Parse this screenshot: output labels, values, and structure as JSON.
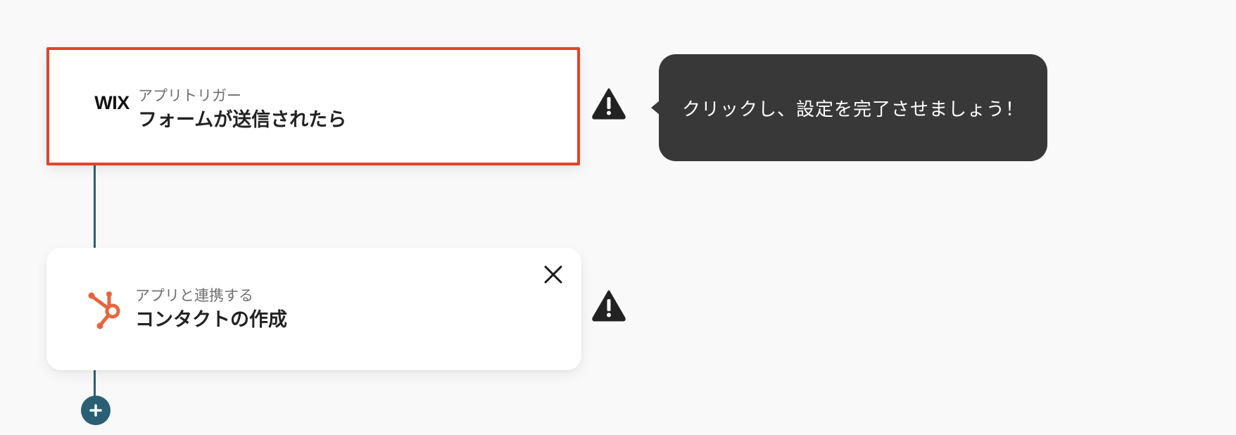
{
  "flow": {
    "trigger": {
      "app_logo_text": "WIX",
      "label": "アプリトリガー",
      "title": "フォームが送信されたら",
      "highlight_color": "#e2432a",
      "status_icon": "warning-icon"
    },
    "action": {
      "app_logo": "hubspot-icon",
      "label": "アプリと連携する",
      "title": "コンタクトの作成",
      "close_icon": "close-icon",
      "status_icon": "warning-icon"
    },
    "add_step_icon": "plus-icon",
    "connector_color": "#2b5f73"
  },
  "tooltip": {
    "text": "クリックし、設定を完了させましょう！",
    "background": "#383838"
  }
}
